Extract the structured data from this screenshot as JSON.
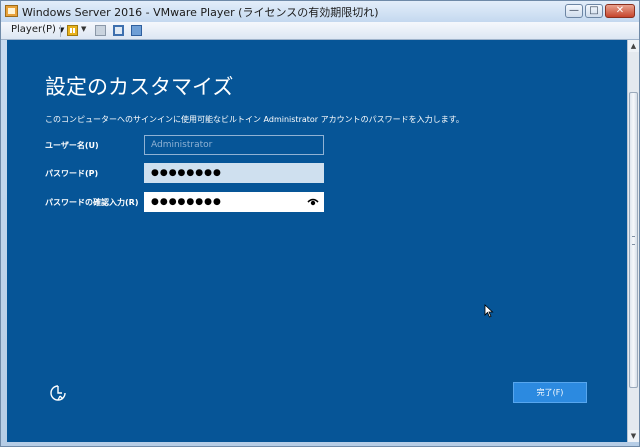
{
  "window": {
    "title": "Windows Server 2016 - VMware Player (ライセンスの有効期限切れ)",
    "buttons": {
      "minimize": "—",
      "maximize": "□",
      "close": "✕"
    }
  },
  "toolbar": {
    "player_menu": "Player(P)",
    "dropdown_glyph": "▼",
    "icons": [
      "pause-icon",
      "network-icon",
      "fullscreen-icon",
      "unity-icon"
    ]
  },
  "setup": {
    "heading": "設定のカスタマイズ",
    "description": "このコンピューターへのサインインに使用可能なビルトイン Administrator アカウントのパスワードを入力します。",
    "username_label": "ユーザー名(U)",
    "username_placeholder": "Administrator",
    "password_label": "パスワード(P)",
    "password_value": "●●●●●●●●",
    "confirm_label": "パスワードの確認入力(R)",
    "confirm_value": "●●●●●●●●",
    "finish_button": "完了(F)"
  },
  "colors": {
    "screen_bg": "#065597",
    "button_bg": "#2c8ae0",
    "text": "#ffffff"
  }
}
